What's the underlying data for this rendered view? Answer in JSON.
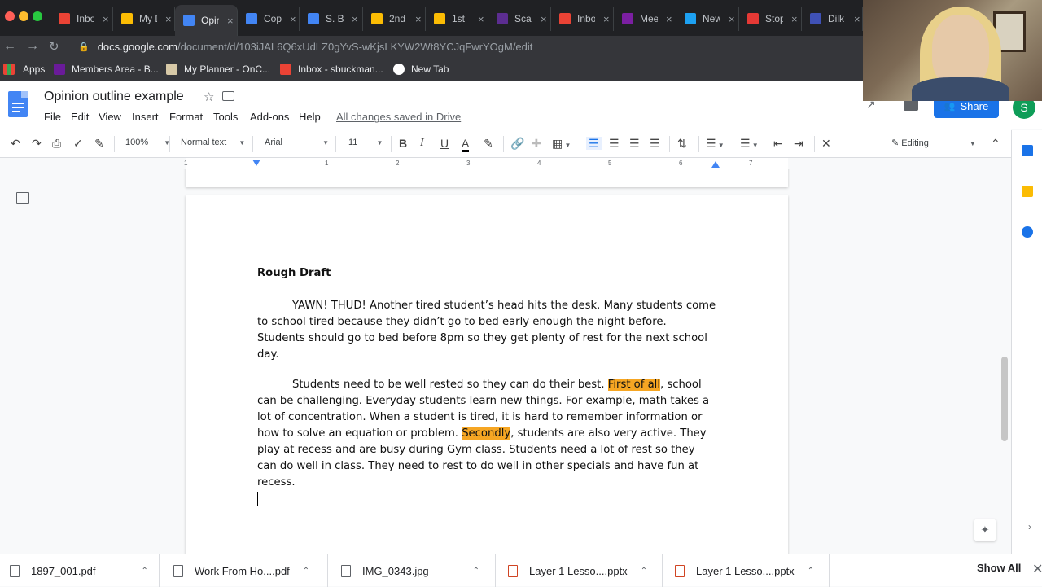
{
  "browser": {
    "tabs": [
      {
        "title": "Inbox",
        "color": "#ea4335"
      },
      {
        "title": "My Drive",
        "color": "#fbbc04"
      },
      {
        "title": "Opinion outline example",
        "color": "#4285f4",
        "active": true
      },
      {
        "title": "Copy",
        "color": "#4285f4"
      },
      {
        "title": "S. B",
        "color": "#4285f4"
      },
      {
        "title": "2nd",
        "color": "#fbbc04"
      },
      {
        "title": "1st",
        "color": "#fbbc04"
      },
      {
        "title": "Scan",
        "color": "#5c2d91"
      },
      {
        "title": "Inbox",
        "color": "#ea4335"
      },
      {
        "title": "Meet",
        "color": "#7b1fa2"
      },
      {
        "title": "New",
        "color": "#1da1f2"
      },
      {
        "title": "Stop",
        "color": "#e53935"
      },
      {
        "title": "Dilk",
        "color": "#3f51b5"
      }
    ],
    "url_host": "docs.google.com",
    "url_path": "/document/d/103iJAL6Q6xUdLZ0gYvS-wKjsLKYW2Wt8YCJqFwrYOgM/edit",
    "bookmarks": [
      "Apps",
      "Members Area - B...",
      "My Planner - OnC...",
      "Inbox - sbuckman...",
      "New Tab"
    ]
  },
  "docs": {
    "title": "Opinion outline example",
    "menus": [
      "File",
      "Edit",
      "View",
      "Insert",
      "Format",
      "Tools",
      "Add-ons",
      "Help"
    ],
    "saved_status": "All changes saved in Drive",
    "share_label": "Share",
    "avatar_initial": "S",
    "editing_mode": "Editing"
  },
  "toolbar": {
    "zoom": "100%",
    "style": "Normal text",
    "font": "Arial",
    "font_size": "11"
  },
  "ruler": {
    "numbers": [
      "1",
      "1",
      "2",
      "3",
      "4",
      "5",
      "6",
      "7"
    ]
  },
  "document": {
    "heading": "Rough Draft",
    "paragraph1": "YAWN! THUD! Another tired student’s head hits the desk. Many students come to school tired because they didn’t go to bed early enough the night before. Students should go to bed before 8pm so they get plenty of rest for the next school day.",
    "p2_before": "Students need to be well rested so they can do their best. ",
    "p2_hl1": "First of all",
    "p2_middle": ", school can be challenging. Everyday students learn new things. For example, math takes a lot of concentration. When a student is tired, it is hard to remember information or how to solve an equation or problem.  ",
    "p2_hl2": "Secondly",
    "p2_after": ", students are also very active. They play at recess and are busy during Gym class. Students need a lot of rest so they can do well in class. They need to rest to do well in other specials and have fun at recess."
  },
  "downloads": {
    "items": [
      "1897_001.pdf",
      "Work From Ho....pdf",
      "IMG_0343.jpg",
      "Layer 1 Lesso....pptx",
      "Layer 1 Lesso....pptx"
    ],
    "show_all": "Show All"
  }
}
